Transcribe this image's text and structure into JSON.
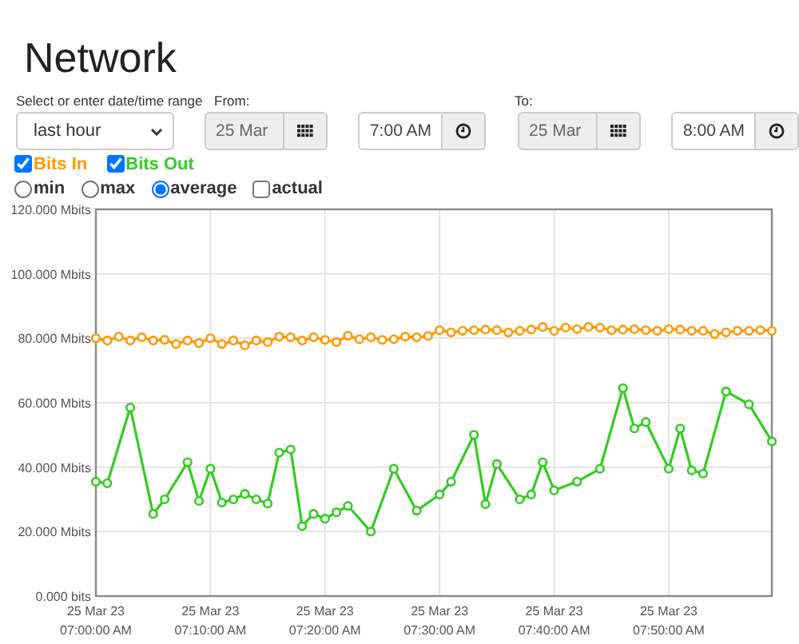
{
  "title": "Network",
  "range": {
    "label": "Select or enter date/time range",
    "value": "last hour"
  },
  "from": {
    "label": "From:",
    "date": "25 Mar",
    "time": "7:00 AM"
  },
  "to": {
    "label": "To:",
    "date": "25 Mar",
    "time": "8:00 AM"
  },
  "series_toggles": [
    {
      "checked": true
    },
    {
      "checked": true
    }
  ],
  "x_axis_dates": [
    "25 Mar 23",
    "25 Mar 23",
    "25 Mar 23",
    "25 Mar 23",
    "25 Mar 23",
    "25 Mar 23"
  ],
  "modes": [
    {
      "kind": "radio",
      "label": "min",
      "selected": false
    },
    {
      "kind": "radio",
      "label": "max",
      "selected": false
    },
    {
      "kind": "radio",
      "label": "average",
      "selected": true
    },
    {
      "kind": "checkbox",
      "label": "actual",
      "selected": false
    }
  ],
  "chart_data": {
    "type": "line",
    "xlim": [
      25200,
      28740
    ],
    "ylim": [
      0,
      120
    ],
    "grid": true,
    "xticks": [
      {
        "value": 25200,
        "label": "07:00:00 AM"
      },
      {
        "value": 25800,
        "label": "07:10:00 AM"
      },
      {
        "value": 26400,
        "label": "07:20:00 AM"
      },
      {
        "value": 27000,
        "label": "07:30:00 AM"
      },
      {
        "value": 27600,
        "label": "07:40:00 AM"
      },
      {
        "value": 28200,
        "label": "07:50:00 AM"
      }
    ],
    "yticks": [
      {
        "value": 0,
        "label": "0.000 bits"
      },
      {
        "value": 20,
        "label": "20.000 Mbits"
      },
      {
        "value": 40,
        "label": "40.000 Mbits"
      },
      {
        "value": 60,
        "label": "60.000 Mbits"
      },
      {
        "value": 80,
        "label": "80.000 Mbits"
      },
      {
        "value": 100,
        "label": "100.000 Mbits"
      },
      {
        "value": 120,
        "label": "120.000 Mbits"
      }
    ],
    "series": [
      {
        "name": "Bits In",
        "color": "#ff9900",
        "marker": "circle",
        "x": [
          25200,
          25260,
          25320,
          25380,
          25440,
          25500,
          25560,
          25620,
          25680,
          25740,
          25800,
          25860,
          25920,
          25980,
          26040,
          26100,
          26160,
          26220,
          26280,
          26340,
          26400,
          26460,
          26520,
          26580,
          26640,
          26700,
          26760,
          26820,
          26880,
          26940,
          27000,
          27060,
          27120,
          27180,
          27240,
          27300,
          27360,
          27420,
          27480,
          27540,
          27600,
          27660,
          27720,
          27780,
          27840,
          27900,
          27960,
          28020,
          28080,
          28140,
          28200,
          28260,
          28320,
          28380,
          28440,
          28500,
          28560,
          28620,
          28680,
          28740
        ],
        "values": [
          80,
          79.3,
          80.5,
          79.3,
          80.3,
          79.3,
          79.5,
          78.2,
          79.3,
          78.5,
          80,
          78.2,
          79.3,
          77.8,
          79.3,
          78.8,
          80.5,
          80.3,
          79.3,
          80.3,
          79.5,
          78.8,
          80.8,
          79.7,
          80.3,
          79.5,
          79.7,
          80.5,
          80.3,
          80.7,
          82.5,
          81.8,
          82.3,
          82.5,
          82.7,
          82.5,
          81.8,
          82.3,
          82.7,
          83.5,
          82.3,
          83.3,
          82.8,
          83.5,
          83.3,
          82.5,
          82.7,
          82.8,
          82.5,
          82.3,
          82.8,
          82.7,
          82.3,
          82.3,
          81.3,
          81.8,
          82.3,
          82.3,
          82.5,
          82.3
        ]
      },
      {
        "name": "Bits Out",
        "color": "#33cc22",
        "marker": "circle",
        "x": [
          25200,
          25260,
          25380,
          25500,
          25560,
          25680,
          25740,
          25800,
          25860,
          25920,
          25980,
          26040,
          26100,
          26160,
          26220,
          26280,
          26340,
          26400,
          26460,
          26520,
          26640,
          26760,
          26880,
          27000,
          27060,
          27180,
          27240,
          27300,
          27420,
          27480,
          27540,
          27600,
          27720,
          27840,
          27960,
          28020,
          28080,
          28200,
          28260,
          28320,
          28380,
          28500,
          28620,
          28740
        ],
        "values": [
          35.5,
          35,
          58.5,
          25.5,
          30,
          41.5,
          29.5,
          39.5,
          29,
          30,
          31.7,
          30,
          28.7,
          44.5,
          45.5,
          21.7,
          25.5,
          24,
          26,
          28,
          20,
          39.5,
          26.5,
          31.5,
          35.5,
          50,
          28.5,
          41,
          30,
          31.5,
          41.5,
          32.8,
          35.5,
          39.5,
          64.5,
          52,
          54,
          39.5,
          52,
          39,
          38,
          63.5,
          59.5,
          48
        ]
      }
    ]
  }
}
